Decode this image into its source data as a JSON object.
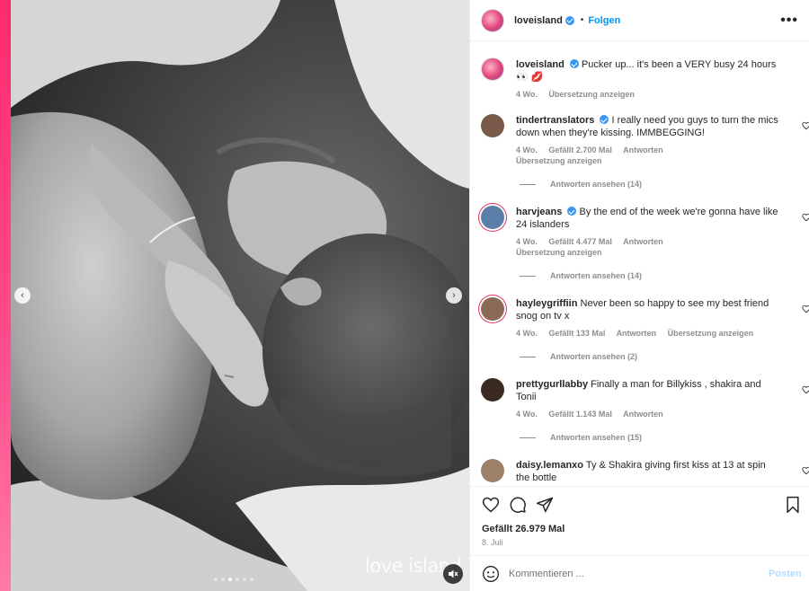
{
  "post": {
    "account": "loveisland",
    "follow_label": "Folgen",
    "more_label": "•••",
    "watermark": "love island",
    "carousel_dots": 6,
    "active_dot": 2,
    "prev_label": "‹",
    "next_label": "›"
  },
  "caption": {
    "username": "loveisland",
    "text": "Pucker up... it's been a VERY busy 24 hours 👀 💋",
    "age": "4 Wo.",
    "translate": "Übersetzung anzeigen"
  },
  "comments": [
    {
      "username": "tindertranslators",
      "verified": true,
      "text": "I really need you guys to turn the mics down when they're kissing. IMMBEGGING!",
      "age": "4 Wo.",
      "likes": "Gefällt 2.700 Mal",
      "reply": "Antworten",
      "translate": "Übersetzung anzeigen",
      "view_replies": "Antworten ansehen (14)",
      "avatar_color": "#7a5a4a"
    },
    {
      "username": "harvjeans",
      "verified": true,
      "text": "By the end of the week we're gonna have like 24 islanders",
      "age": "4 Wo.",
      "likes": "Gefällt 4.477 Mal",
      "reply": "Antworten",
      "translate": "Übersetzung anzeigen",
      "view_replies": "Antworten ansehen (14)",
      "avatar_color": "#5a7fa8"
    },
    {
      "username": "hayleygriffiin",
      "verified": false,
      "text": "Never been so happy to see my best friend snog on tv x",
      "age": "4 Wo.",
      "likes": "Gefällt 133 Mal",
      "reply": "Antworten",
      "translate": "Übersetzung anzeigen",
      "view_replies": "Antworten ansehen (2)",
      "avatar_color": "#8a6b55"
    },
    {
      "username": "prettygurllabby",
      "verified": false,
      "text": "Finally a man for Billykiss , shakira and Tonii",
      "age": "4 Wo.",
      "likes": "Gefällt 1.143 Mal",
      "reply": "Antworten",
      "view_replies": "Antworten ansehen (15)",
      "avatar_color": "#3b2a22"
    },
    {
      "username": "daisy.lemanxo",
      "verified": false,
      "text": "Ty & Shakira giving first kiss at 13 at spin the bottle",
      "avatar_color": "#9c8068"
    }
  ],
  "footer": {
    "likes": "Gefällt 26.979 Mal",
    "date": "8. Juli",
    "comment_placeholder": "Kommentieren ...",
    "post_label": "Posten"
  },
  "colors": {
    "accent": "#0095f6",
    "verified": "#3897f0",
    "edge": "#ff2a6d"
  },
  "icons": [
    "like-icon",
    "comment-icon",
    "share-icon",
    "save-icon",
    "emoji-icon",
    "mute-icon",
    "more-icon",
    "chevron-left-icon",
    "chevron-right-icon"
  ]
}
